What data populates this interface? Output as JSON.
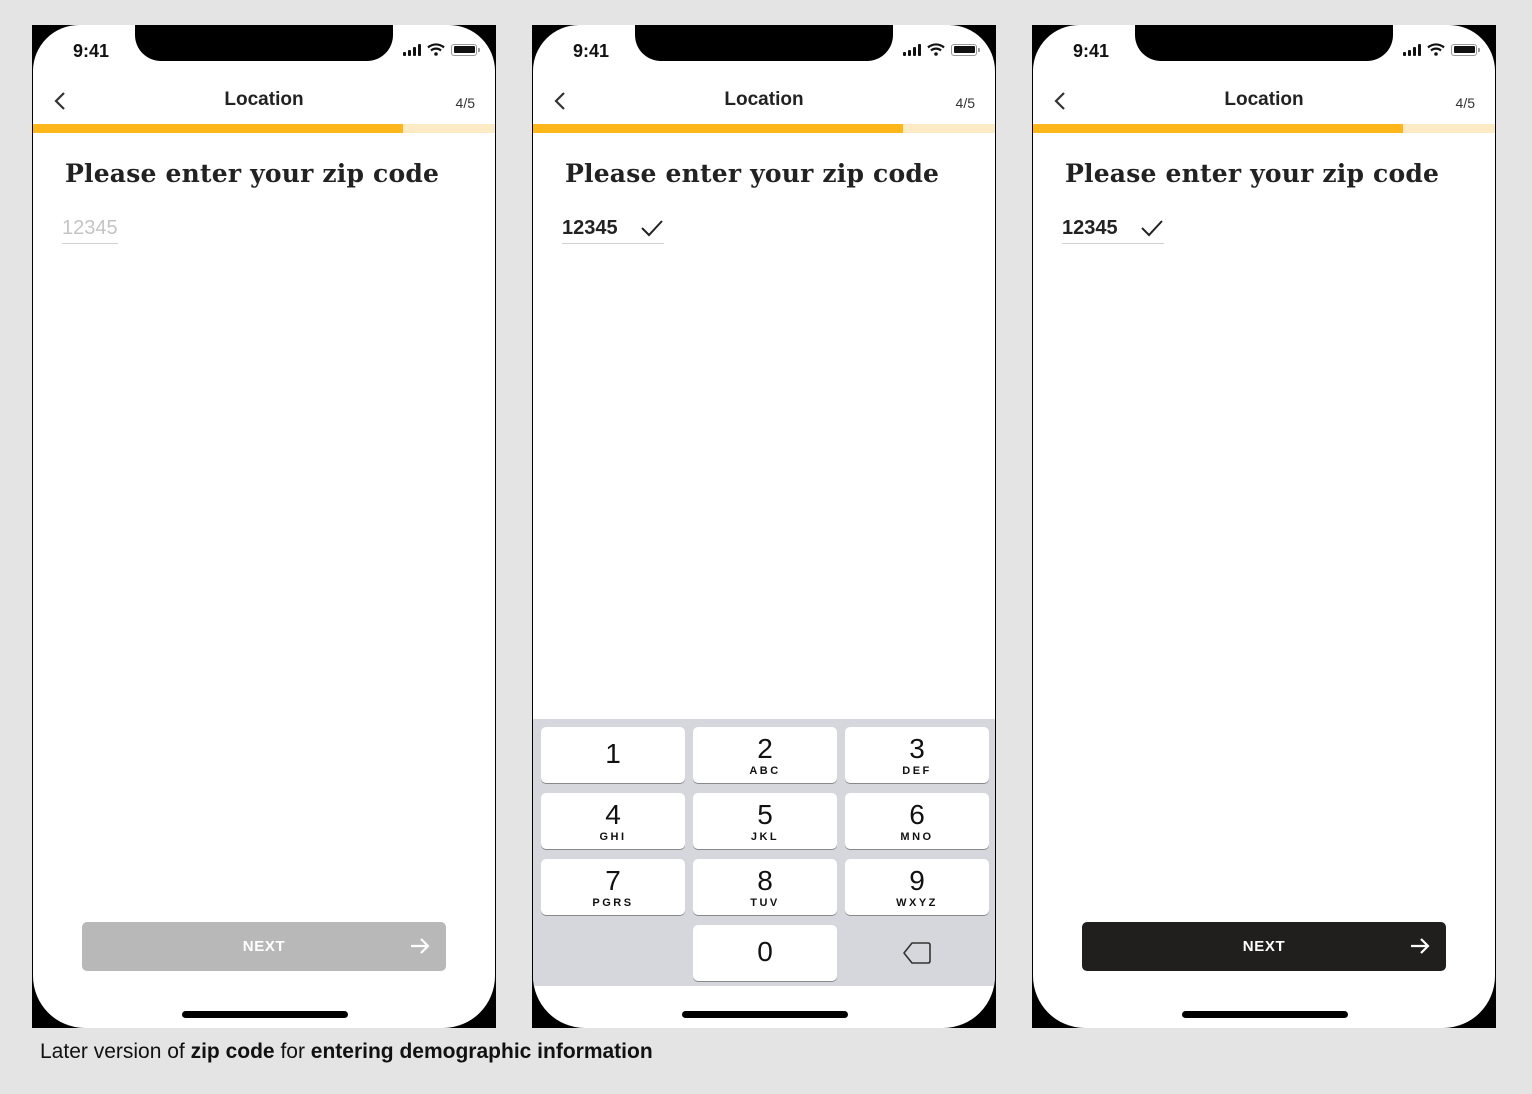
{
  "phones": [
    {
      "status_time": "9:41",
      "nav_title": "Location",
      "step": "4/5",
      "progress": 0.8,
      "heading": "Please enter your zip code",
      "zip_value": "",
      "zip_placeholder": "12345",
      "next_label": "NEXT",
      "next_state": "disabled"
    },
    {
      "status_time": "9:41",
      "nav_title": "Location",
      "step": "4/5",
      "progress": 0.8,
      "heading": "Please enter your zip code",
      "zip_value": "12345",
      "zip_valid": true,
      "keypad": [
        {
          "num": "1",
          "letters": ""
        },
        {
          "num": "2",
          "letters": "ABC"
        },
        {
          "num": "3",
          "letters": "DEF"
        },
        {
          "num": "4",
          "letters": "GHI"
        },
        {
          "num": "5",
          "letters": "JKL"
        },
        {
          "num": "6",
          "letters": "MNO"
        },
        {
          "num": "7",
          "letters": "PGRS"
        },
        {
          "num": "8",
          "letters": "TUV"
        },
        {
          "num": "9",
          "letters": "WXYZ"
        },
        {
          "num": "0",
          "letters": ""
        }
      ]
    },
    {
      "status_time": "9:41",
      "nav_title": "Location",
      "step": "4/5",
      "progress": 0.8,
      "heading": "Please enter your zip code",
      "zip_value": "12345",
      "zip_valid": true,
      "next_label": "NEXT",
      "next_state": "enabled"
    }
  ],
  "caption": {
    "part1": "Later version of ",
    "bold1": "zip code",
    "part2": " for ",
    "bold2": "entering demographic information"
  },
  "colors": {
    "progress_fill": "#fdb71a",
    "progress_track": "#fdebc6",
    "next_disabled": "#b8b8b8",
    "next_enabled": "#201f1e"
  }
}
